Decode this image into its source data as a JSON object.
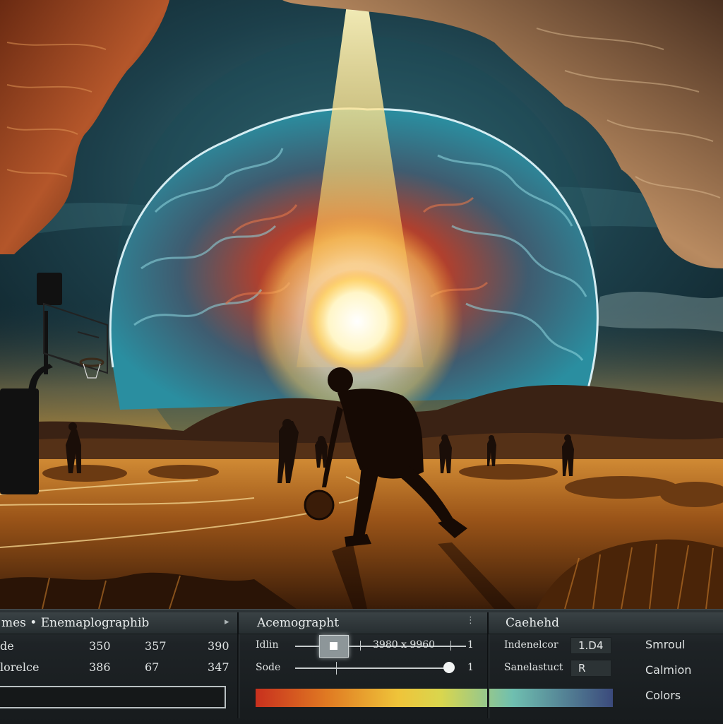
{
  "colors": {
    "panel_bg": "#1e2326",
    "text": "#dfe3e3",
    "accent_sun": "#fff3b0",
    "gradient": [
      "#c8301e",
      "#e07a22",
      "#efc43a",
      "#6fbfb0",
      "#3b4a7c"
    ]
  },
  "left_panel": {
    "title": "mes • Enemaplographib",
    "rows": [
      {
        "label": "de",
        "values": [
          "350",
          "357",
          "390"
        ]
      },
      {
        "label": "lorelce",
        "values": [
          "386",
          "67",
          "347"
        ]
      }
    ],
    "text_value": ""
  },
  "middle_panel": {
    "title": "Acemographt",
    "width_label": "Idlin",
    "width_value": "3980 x 9960",
    "width_end": "1",
    "size_label": "Sode",
    "size_end": "1",
    "gradient_icon": "color-gradient-bar"
  },
  "right_panel": {
    "title": "Caehehd",
    "field1_label": "Indenelcor",
    "field1_value": "1.D4",
    "field2_label": "Sanelastuct",
    "field2_value": "R",
    "options": [
      "Smroul",
      "Calmion",
      "Colors"
    ]
  },
  "icons": {
    "expand": "chevron-right-icon",
    "handle": "drag-handle-icon"
  }
}
